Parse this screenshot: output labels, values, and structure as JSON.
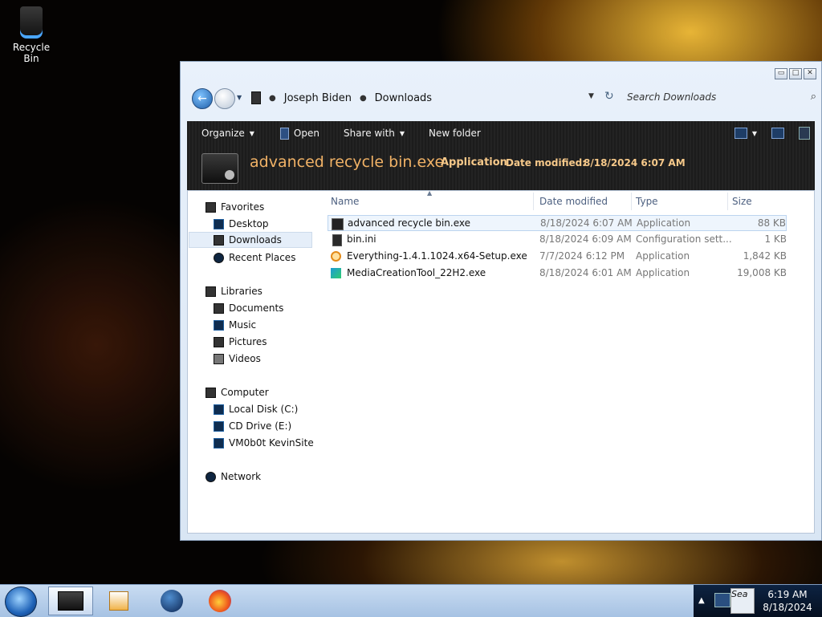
{
  "desktop": {
    "recycle_bin_label": "Recycle Bin"
  },
  "window": {
    "controls": {
      "minimize": "▭",
      "maximize": "□",
      "close": "✕"
    },
    "breadcrumbs": [
      "Joseph Biden",
      "Downloads"
    ],
    "search_placeholder": "Search Downloads",
    "toolbar": {
      "organize": "Organize",
      "open": "Open",
      "share_with": "Share with",
      "new_folder": "New folder"
    },
    "details": {
      "file_name": "advanced recycle bin.exe",
      "file_type": "Application",
      "date_modified_label": "Date modified:",
      "date_modified_value": "8/18/2024 6:07 AM"
    },
    "nav": {
      "favorites": "Favorites",
      "desktop": "Desktop",
      "downloads": "Downloads",
      "recent_places": "Recent Places",
      "libraries": "Libraries",
      "documents": "Documents",
      "music": "Music",
      "pictures": "Pictures",
      "videos": "Videos",
      "computer": "Computer",
      "local_disk": "Local Disk (C:)",
      "cd_drive": "CD Drive (E:)",
      "vm_share": "VM0b0t KevinSite",
      "network": "Network"
    },
    "columns": {
      "name": "Name",
      "date_modified": "Date modified",
      "type": "Type",
      "size": "Size"
    },
    "files": [
      {
        "name": "advanced recycle bin.exe",
        "date": "8/18/2024 6:07 AM",
        "type": "Application",
        "size": "88 KB",
        "icon": "exe-icon"
      },
      {
        "name": "bin.ini",
        "date": "8/18/2024 6:09 AM",
        "type": "Configuration sett...",
        "size": "1 KB",
        "icon": "ini-file-icon"
      },
      {
        "name": "Everything-1.4.1.1024.x64-Setup.exe",
        "date": "7/7/2024 6:12 PM",
        "type": "Application",
        "size": "1,842 KB",
        "icon": "magnifier-icon"
      },
      {
        "name": "MediaCreationTool_22H2.exe",
        "date": "8/18/2024 6:01 AM",
        "type": "Application",
        "size": "19,008 KB",
        "icon": "media-creation-tool-icon"
      }
    ]
  },
  "taskbar": {
    "search_tray_text": "Sea",
    "time": "6:19 AM",
    "date": "8/18/2024"
  },
  "colors": {
    "details_text": "#f7c98a",
    "accent": "#1f63b8"
  }
}
